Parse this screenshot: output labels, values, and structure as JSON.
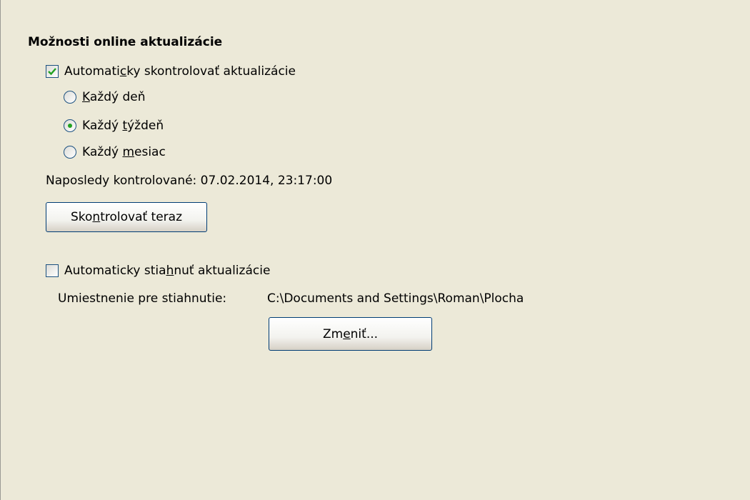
{
  "section": {
    "title": "Možnosti online aktualizácie"
  },
  "auto_check": {
    "checked": true,
    "label_before": "Automati",
    "label_access": "c",
    "label_after": "ky skontrolovať aktualizácie"
  },
  "frequency": {
    "selected": "weekly",
    "options": [
      {
        "id": "daily",
        "before": "",
        "access": "K",
        "after": "aždý deň"
      },
      {
        "id": "weekly",
        "before": "Každý ",
        "access": "t",
        "after": "ýždeň"
      },
      {
        "id": "monthly",
        "before": "Každý ",
        "access": "m",
        "after": "esiac"
      }
    ]
  },
  "last_checked": {
    "text": "Naposledy kontrolované: 07.02.2014, 23:17:00"
  },
  "check_now_button": {
    "before": "Sko",
    "access": "n",
    "after": "trolovať teraz"
  },
  "auto_download": {
    "checked": false,
    "label_before": "Automaticky stia",
    "label_access": "h",
    "label_after": "nuť aktualizácie"
  },
  "download_location": {
    "label": "Umiestnenie pre stiahnutie:",
    "path": "C:\\Documents and Settings\\Roman\\Plocha"
  },
  "change_button": {
    "before": "Zm",
    "access": "e",
    "after": "niť..."
  },
  "colors": {
    "background": "#ece9d8",
    "control_border": "#1c5180",
    "check_mark": "#21a121",
    "radio_dot": "#21a121"
  }
}
